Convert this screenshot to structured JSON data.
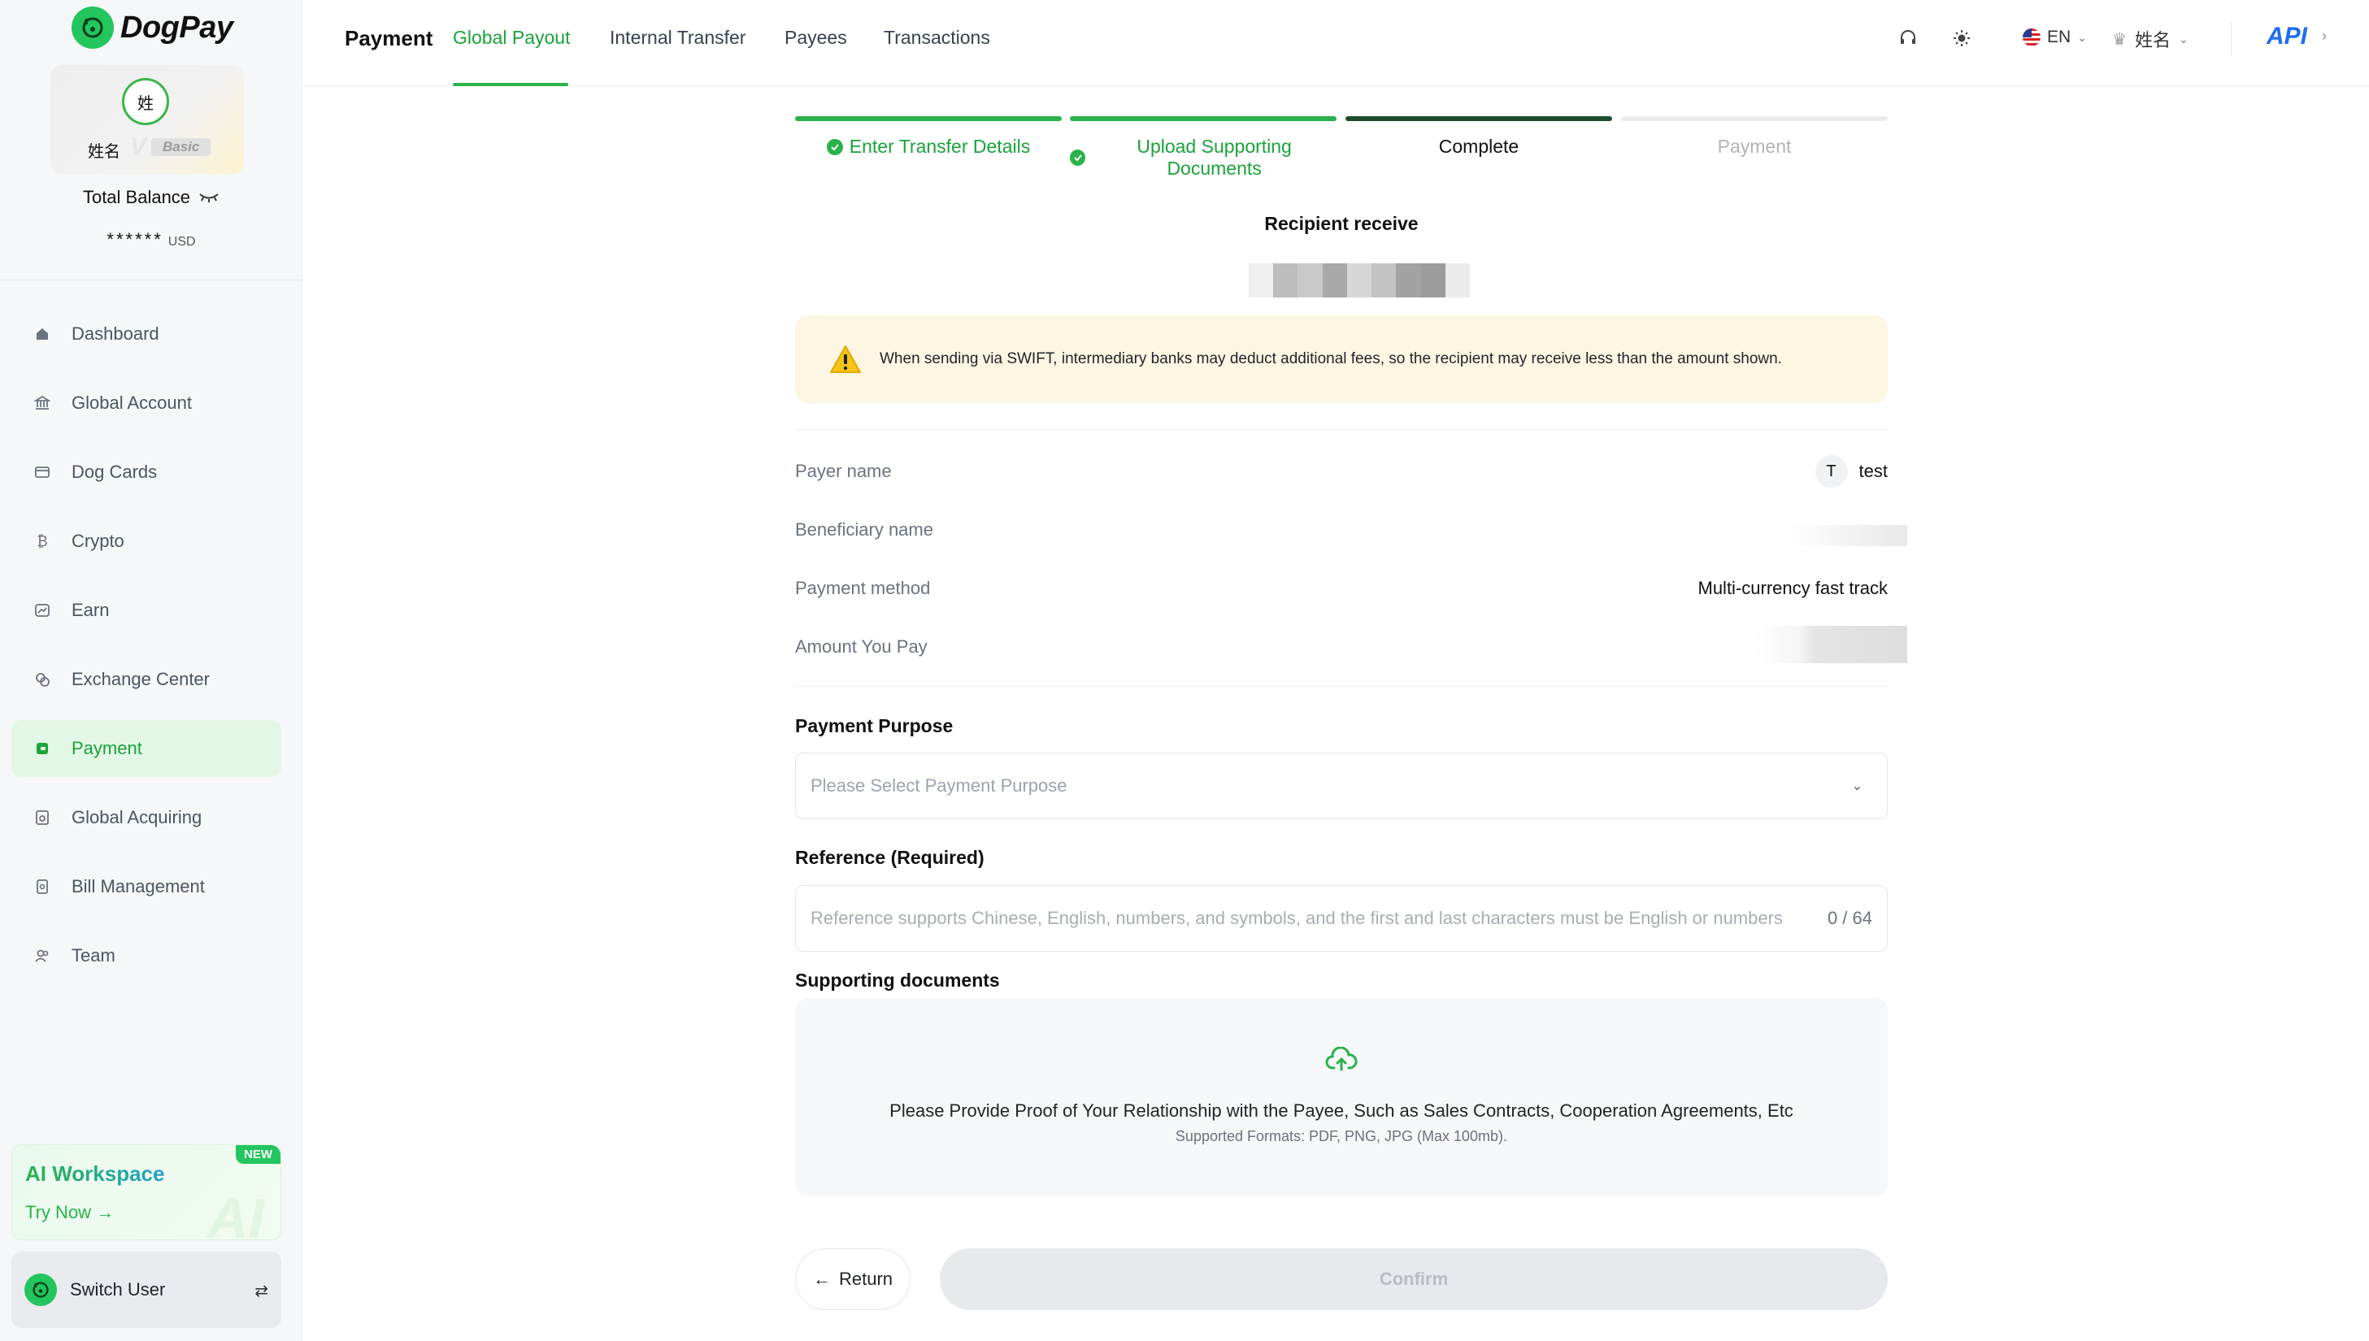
{
  "sidebar": {
    "brand": "DogPay",
    "profile": {
      "avatar_char": "姓",
      "name": "姓名",
      "tier": "Basic",
      "tier_letter": "V"
    },
    "balance": {
      "label": "Total Balance",
      "amount": "******",
      "currency": "USD"
    },
    "items": [
      {
        "label": "Dashboard",
        "icon": "dashboard-icon"
      },
      {
        "label": "Global Account",
        "icon": "bank-icon"
      },
      {
        "label": "Dog Cards",
        "icon": "card-icon"
      },
      {
        "label": "Crypto",
        "icon": "bitcoin-icon"
      },
      {
        "label": "Earn",
        "icon": "earn-icon"
      },
      {
        "label": "Exchange Center",
        "icon": "exchange-icon"
      },
      {
        "label": "Payment",
        "icon": "payment-icon",
        "active": true
      },
      {
        "label": "Global Acquiring",
        "icon": "acquiring-icon"
      },
      {
        "label": "Bill Management",
        "icon": "bill-icon"
      },
      {
        "label": "Team",
        "icon": "team-icon"
      }
    ],
    "ai_workspace": {
      "title": "AI Workspace",
      "cta": "Try Now",
      "badge": "NEW",
      "bg_text": "AI"
    },
    "switch_user": {
      "label": "Switch User"
    }
  },
  "header": {
    "title": "Payment",
    "tabs": [
      {
        "label": "Global Payout",
        "active": true
      },
      {
        "label": "Internal Transfer"
      },
      {
        "label": "Payees"
      },
      {
        "label": "Transactions"
      }
    ],
    "language": "EN",
    "user_name": "姓名",
    "api_label": "API"
  },
  "steps": [
    {
      "label": "Enter Transfer Details",
      "state": "done"
    },
    {
      "label": "Upload Supporting Documents",
      "state": "done"
    },
    {
      "label": "Complete",
      "state": "current"
    },
    {
      "label": "Payment",
      "state": "pending"
    }
  ],
  "recipient": {
    "title": "Recipient receive"
  },
  "warning": {
    "text": "When sending via SWIFT, intermediary banks may deduct additional fees, so the recipient may receive less than the amount shown."
  },
  "details": {
    "payer_label": "Payer name",
    "payer_initial": "T",
    "payer_value": "test",
    "beneficiary_label": "Beneficiary name",
    "method_label": "Payment method",
    "method_value": "Multi-currency fast track",
    "amount_label": "Amount You Pay"
  },
  "form": {
    "purpose_label": "Payment Purpose",
    "purpose_placeholder": "Please Select Payment Purpose",
    "reference_label": "Reference (Required)",
    "reference_placeholder": "Reference supports Chinese, English, numbers, and symbols, and the first and last characters must be English or numbers",
    "reference_counter": "0 / 64",
    "docs_label": "Supporting documents",
    "docs_main": "Please Provide Proof of Your Relationship with the Payee, Such as Sales Contracts, Cooperation Agreements, Etc",
    "docs_sub": "Supported Formats: PDF, PNG, JPG (Max 100mb)."
  },
  "actions": {
    "return_label": "Return",
    "confirm_label": "Confirm"
  },
  "colors": {
    "brand_green": "#2ab24b",
    "warning_bg": "#fdf6e3",
    "api_blue": "#1d6df2"
  }
}
